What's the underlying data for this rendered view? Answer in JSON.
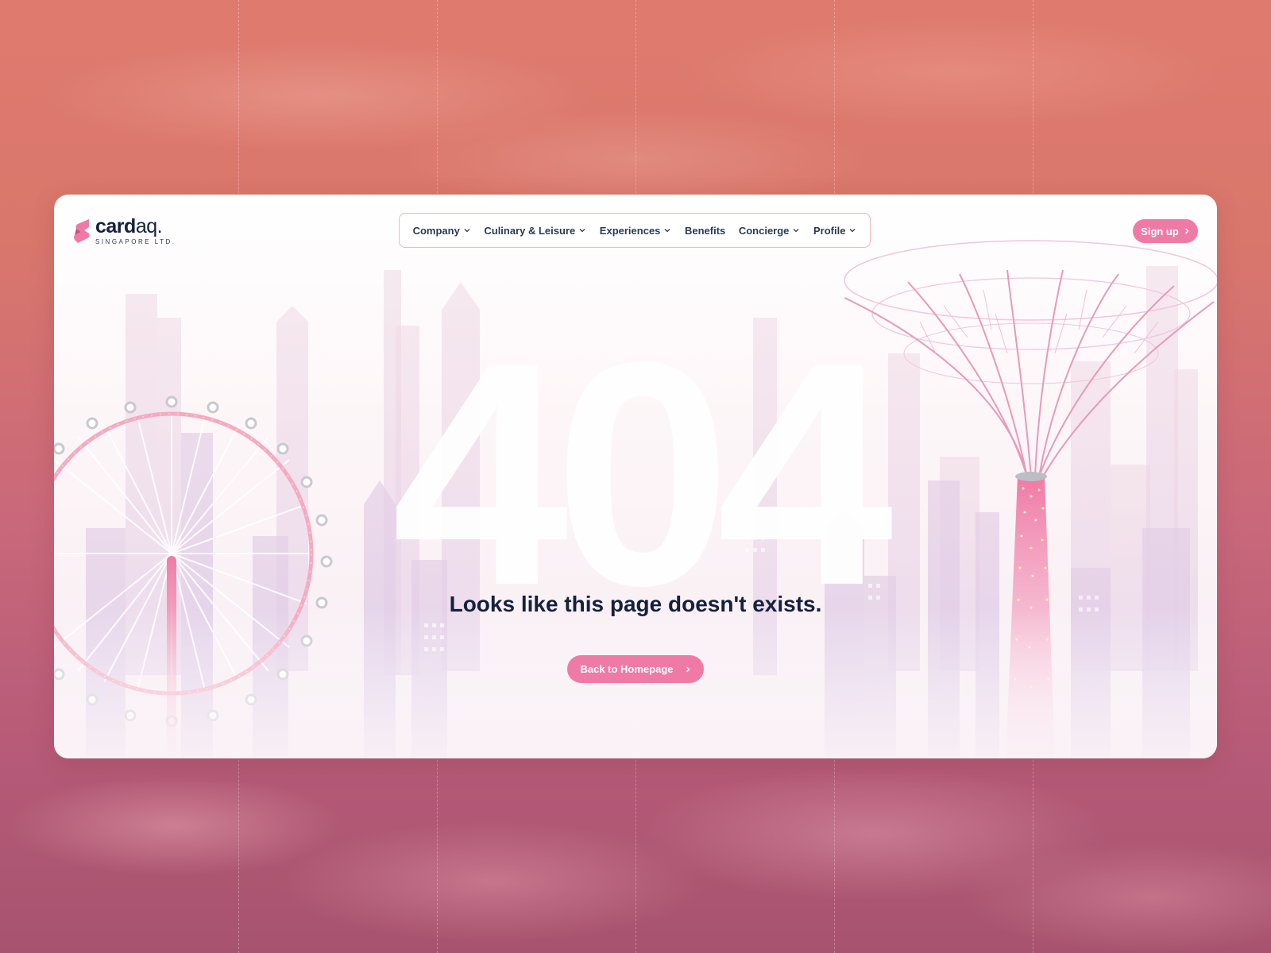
{
  "brand": {
    "name_bold": "card",
    "name_light": "aq.",
    "subtitle": "SINGAPORE LTD.",
    "accent_color": "#f07aa6"
  },
  "nav": {
    "items": [
      {
        "label": "Company",
        "dropdown": true
      },
      {
        "label": "Culinary & Leisure",
        "dropdown": true
      },
      {
        "label": "Experiences",
        "dropdown": true
      },
      {
        "label": "Benefits",
        "dropdown": false
      },
      {
        "label": "Concierge",
        "dropdown": true
      },
      {
        "label": "Profile",
        "dropdown": true
      }
    ],
    "signup_label": "Sign up"
  },
  "error": {
    "code": "404",
    "message": "Looks like this page doesn't exists.",
    "button_label": "Back to Homepage"
  },
  "icons": {
    "dropdown": "chevron-down-icon",
    "button_arrow": "chevron-right-icon",
    "logo": "cardaq-logo-icon"
  }
}
